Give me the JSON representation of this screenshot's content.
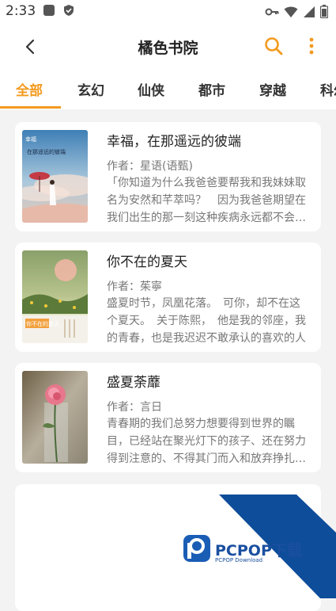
{
  "status": {
    "time": "2:33"
  },
  "header": {
    "title": "橘色书院"
  },
  "tabs": [
    {
      "label": "全部",
      "active": true
    },
    {
      "label": "玄幻",
      "active": false
    },
    {
      "label": "仙侠",
      "active": false
    },
    {
      "label": "都市",
      "active": false
    },
    {
      "label": "穿越",
      "active": false
    },
    {
      "label": "科幻",
      "active": false
    }
  ],
  "books": [
    {
      "title": "幸福，在那遥远的彼端",
      "author": "作者：星语(语甄)",
      "desc": "「你知道为什么我爸爸要帮我和我妹妹取名为安然和芊萃吗？　因为我爸爸期望在我们出生的那一刻这种疾病永远都不会在我们身上出现",
      "cover_text": "在那遥远的彼端"
    },
    {
      "title": "你不在的夏天",
      "author": "作者：茱寧",
      "desc": "盛夏时节，凤凰花落。　可你，却不在这个夏天。　关于陈熙，　他是我的邻座，我的青春，也是我迟迟不敢承认的喜欢的人",
      "cover_text": "你不在的夏天"
    },
    {
      "title": "盛夏荼蘼",
      "author": "作者：言日",
      "desc": "青春期的我们总努力想要得到世界的瞩目，已经站在聚光灯下的孩子、还在努力得到注意的、不得其门而入和放弃挣扎的孩子们",
      "cover_text": ""
    }
  ],
  "watermark": {
    "brand": "PCPOP下载",
    "sub": "PCPOP Download"
  },
  "colors": {
    "accent": "#f39a1f",
    "watermark": "#1a4fa0"
  }
}
